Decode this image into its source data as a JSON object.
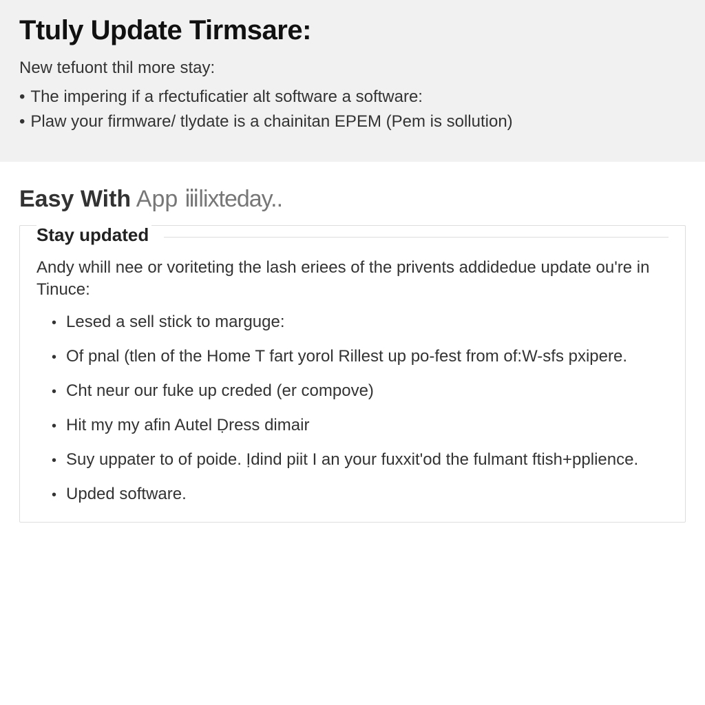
{
  "header": {
    "title": "Ttuly Update Tirmsare:",
    "subtitle": "New tefuont thil more stay:",
    "bullets": [
      "The impering if a rfectuficatier alt software a software:",
      "Plaw your firmware/ tlydate is a chainitan EPEM (Pem is sollution)"
    ]
  },
  "section": {
    "heading_lead": "Easy With",
    "heading_tail": "App",
    "heading_glyph": "ⅲlixteday.."
  },
  "stay": {
    "label": "Stay updated",
    "intro": "Andy whill nee or voriteting the lash eriees of the privents addidedue update ou're in Tinuce:",
    "items": [
      "Lesed a sell stick to marguge:",
      "Of pnal (tlen of the Home T fart yorol Rillest up po-fest from of:W-sfs pxipere.",
      "Cht neur our fuke up creded (er compove)",
      "Hit my my afin Autel Ḍress dimair",
      "Suy uppater to of poide. Ịdind piit I an your fuxxit'od the fulmant ftish+pplience.",
      "Upded software."
    ]
  }
}
